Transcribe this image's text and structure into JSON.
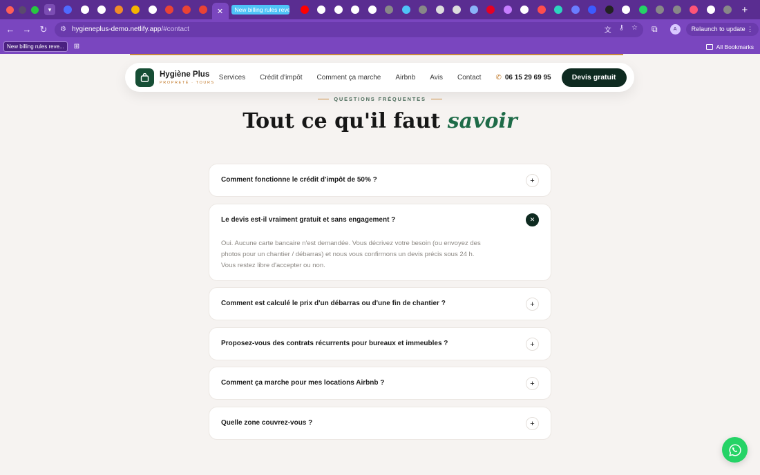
{
  "browser": {
    "active_tab_title": "New billing rules reve...",
    "url_host": "hygieneplus-demo.netlify.app",
    "url_path": "/#contact",
    "relaunch_label": "Relaunch to update",
    "profile_initial": "A",
    "bookmark_chip": "New billing rules reve...",
    "all_bookmarks_label": "All Bookmarks",
    "tab_favicon_colors": [
      "#4f6bff",
      "#ffffff",
      "#ffffff",
      "#f28c28",
      "#f5b400",
      "#ffffff",
      "#ea4335",
      "#ea4335",
      "#ea4335"
    ],
    "tab_favicon_colors_right": [
      "#ff0000",
      "#ffffff",
      "#ffffff",
      "#ffffff",
      "#ffffff",
      "#888888",
      "#4fc3f7",
      "#888888",
      "#dddddd",
      "#dddddd",
      "#8ab4f8",
      "#e60023",
      "#c77dff",
      "#ffffff",
      "#ff4d4d",
      "#2dd4bf",
      "#6a7dff",
      "#3b5bff",
      "#222222",
      "#ffffff",
      "#25d366",
      "#888888",
      "#888888",
      "#ff5577",
      "#ffffff",
      "#888888"
    ]
  },
  "site": {
    "brand_name": "Hygiène Plus",
    "brand_tagline": "PROPRETÉ · TOURS",
    "nav": [
      "Services",
      "Crédit d'impôt",
      "Comment ça marche",
      "Airbnb",
      "Avis",
      "Contact"
    ],
    "phone": "06 15 29 69 95",
    "cta_label": "Devis gratuit",
    "accent_color": "#1e6b48",
    "dark_color": "#0e2a20",
    "warm_color": "#c27b2d"
  },
  "faq": {
    "eyebrow": "QUESTIONS FRÉQUENTES",
    "headline_main": "Tout ce qu'il faut ",
    "headline_accent": "savoir",
    "items": [
      {
        "question": "Comment fonctionne le crédit d'impôt de 50% ?",
        "icon": "plus",
        "expanded": false
      },
      {
        "question": "Le devis est-il vraiment gratuit et sans engagement ?",
        "icon": "close",
        "expanded": true,
        "answer": "Oui. Aucune carte bancaire n'est demandée. Vous décrivez votre besoin (ou envoyez des photos pour un chantier / débarras) et nous vous confirmons un devis précis sous 24 h. Vous restez libre d'accepter ou non."
      },
      {
        "question": "Comment est calculé le prix d'un débarras ou d'une fin de chantier ?",
        "icon": "plus",
        "expanded": false
      },
      {
        "question": "Proposez-vous des contrats récurrents pour bureaux et immeubles ?",
        "icon": "plus",
        "expanded": false
      },
      {
        "question": "Comment ça marche pour mes locations Airbnb ?",
        "icon": "plus",
        "expanded": false
      },
      {
        "question": "Quelle zone couvrez-vous ?",
        "icon": "plus",
        "expanded": false
      }
    ]
  },
  "symbols": {
    "plus": "+",
    "close": "✕"
  },
  "floating": {
    "icon": "whatsapp-icon"
  }
}
